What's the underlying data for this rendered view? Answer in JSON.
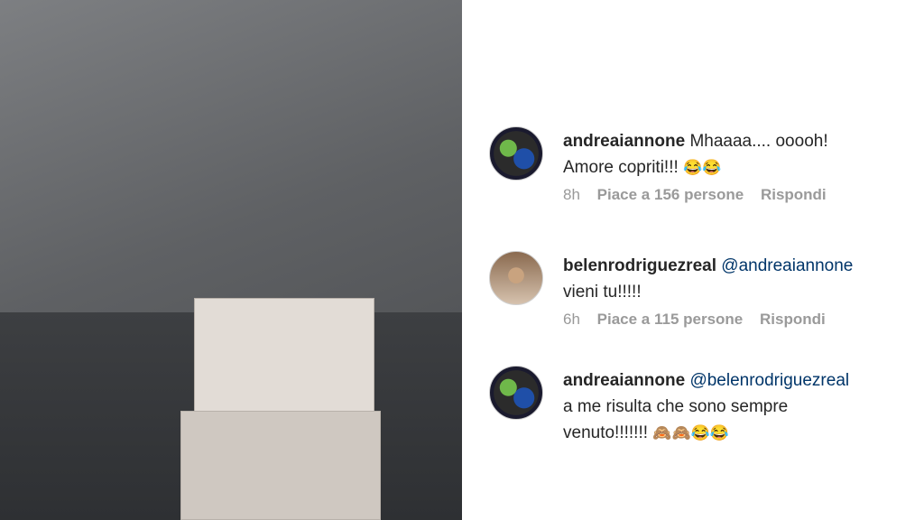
{
  "photo": {
    "alt": ""
  },
  "comments": [
    {
      "username": "andreaiannone",
      "mention": "",
      "text_line1": "Mhaaaa.... ooooh!",
      "text_line2": "Amore copriti!!!",
      "emoji": "😂😂",
      "time": "8h",
      "likes": "Piace a 156 persone",
      "reply": "Rispondi",
      "avatar": "motorcycle-avatar"
    },
    {
      "username": "belenrodriguezreal",
      "mention": "@andreaiannone",
      "text_line1": "",
      "text_line2": "vieni tu!!!!!",
      "emoji": "",
      "time": "6h",
      "likes": "Piace a 115 persone",
      "reply": "Rispondi",
      "avatar": "portrait-avatar"
    },
    {
      "username": "andreaiannone",
      "mention": "@belenrodriguezreal",
      "text_line1": "a me risulta che sono sempre",
      "text_line2": "venuto!!!!!!!",
      "emoji": "🙈🙈😂😂",
      "time": "",
      "likes": "",
      "reply": "",
      "avatar": "motorcycle-avatar"
    }
  ]
}
